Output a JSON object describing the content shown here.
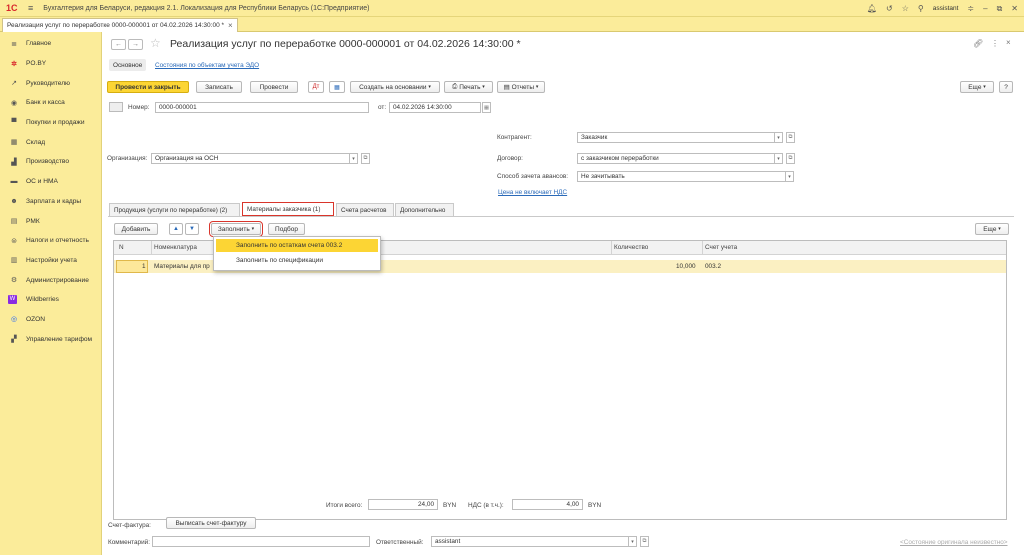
{
  "app": {
    "logo": "1С",
    "title": "Бухгалтерия для Беларуси, редакция 2.1. Локализация для Республики Беларусь  (1С:Предприятие)",
    "user": "assistant"
  },
  "open_tab": {
    "label": "Реализация услуг по переработке 0000-000001 от 04.02.2026 14:30:00 *"
  },
  "sidebar": {
    "items": [
      {
        "label": "Главное",
        "icon": "≣"
      },
      {
        "label": "PO.BY",
        "icon": "✲"
      },
      {
        "label": "Руководителю",
        "icon": "↗"
      },
      {
        "label": "Банк и касса",
        "icon": "◉"
      },
      {
        "label": "Покупки и продажи",
        "icon": "▀"
      },
      {
        "label": "Склад",
        "icon": "▦"
      },
      {
        "label": "Производство",
        "icon": "▟"
      },
      {
        "label": "ОС и НМА",
        "icon": "▬"
      },
      {
        "label": "Зарплата и кадры",
        "icon": "☻"
      },
      {
        "label": "РМК",
        "icon": "▤"
      },
      {
        "label": "Налоги и отчетность",
        "icon": "⊜"
      },
      {
        "label": "Настройки учета",
        "icon": "▥"
      },
      {
        "label": "Администрирование",
        "icon": "⚙"
      },
      {
        "label": "Wildberries",
        "icon": "W"
      },
      {
        "label": "OZON",
        "icon": "◎"
      },
      {
        "label": "Управление тарифом",
        "icon": "▞"
      }
    ]
  },
  "doc": {
    "title": "Реализация услуг по переработке 0000-000001 от 04.02.2026 14:30:00 *",
    "sections": {
      "main": "Основное",
      "edo": "Состояния по объектам учета ЭДО"
    }
  },
  "toolbar": {
    "post_close": "Провести и закрыть",
    "save": "Записать",
    "post": "Провести",
    "create_based": "Создать на основании",
    "print": "Печать",
    "reports": "Отчеты",
    "more": "Еще",
    "help": "?"
  },
  "form": {
    "number_label": "Номер:",
    "number_value": "0000-000001",
    "date_label": "от:",
    "date_value": "04.02.2026 14:30:00",
    "org_label": "Организация:",
    "org_value": "Организация на ОСН",
    "counterparty_label": "Контрагент:",
    "counterparty_value": "Заказчик",
    "contract_label": "Договор:",
    "contract_value": "с заказчиком переработки",
    "advance_label": "Способ зачета авансов:",
    "advance_value": "Не зачитывать",
    "vat_link": "Цена не включает НДС"
  },
  "tabs": [
    {
      "label": "Продукция (услуги по переработке) (2)"
    },
    {
      "label": "Материалы заказчика (1)"
    },
    {
      "label": "Счета расчетов"
    },
    {
      "label": "Дополнительно"
    }
  ],
  "table_toolbar": {
    "add": "Добавить",
    "fill": "Заполнить",
    "select": "Подбор",
    "more": "Еще"
  },
  "table": {
    "headers": {
      "n": "N",
      "item": "Номенклатура",
      "qty": "Количество",
      "account": "Счет учета"
    },
    "rows": [
      {
        "n": "1",
        "item": "Материалы для пр",
        "qty": "10,000",
        "account": "003.2"
      }
    ]
  },
  "fill_menu": {
    "items": [
      {
        "label": "Заполнить по остаткам счета 003.2"
      },
      {
        "label": "Заполнить по спецификации"
      }
    ]
  },
  "footer": {
    "total_label": "Итоги всего:",
    "total_value": "24,00",
    "currency": "BYN",
    "vat_label": "НДС (в т.ч.):",
    "vat_value": "4,00",
    "invoice_label": "Счет-фактура:",
    "invoice_button": "Выписать счет-фактуру",
    "comment_label": "Комментарий:",
    "responsible_label": "Ответственный:",
    "responsible_value": "assistant",
    "original_state": "<Состояние оригинала неизвестно>"
  }
}
